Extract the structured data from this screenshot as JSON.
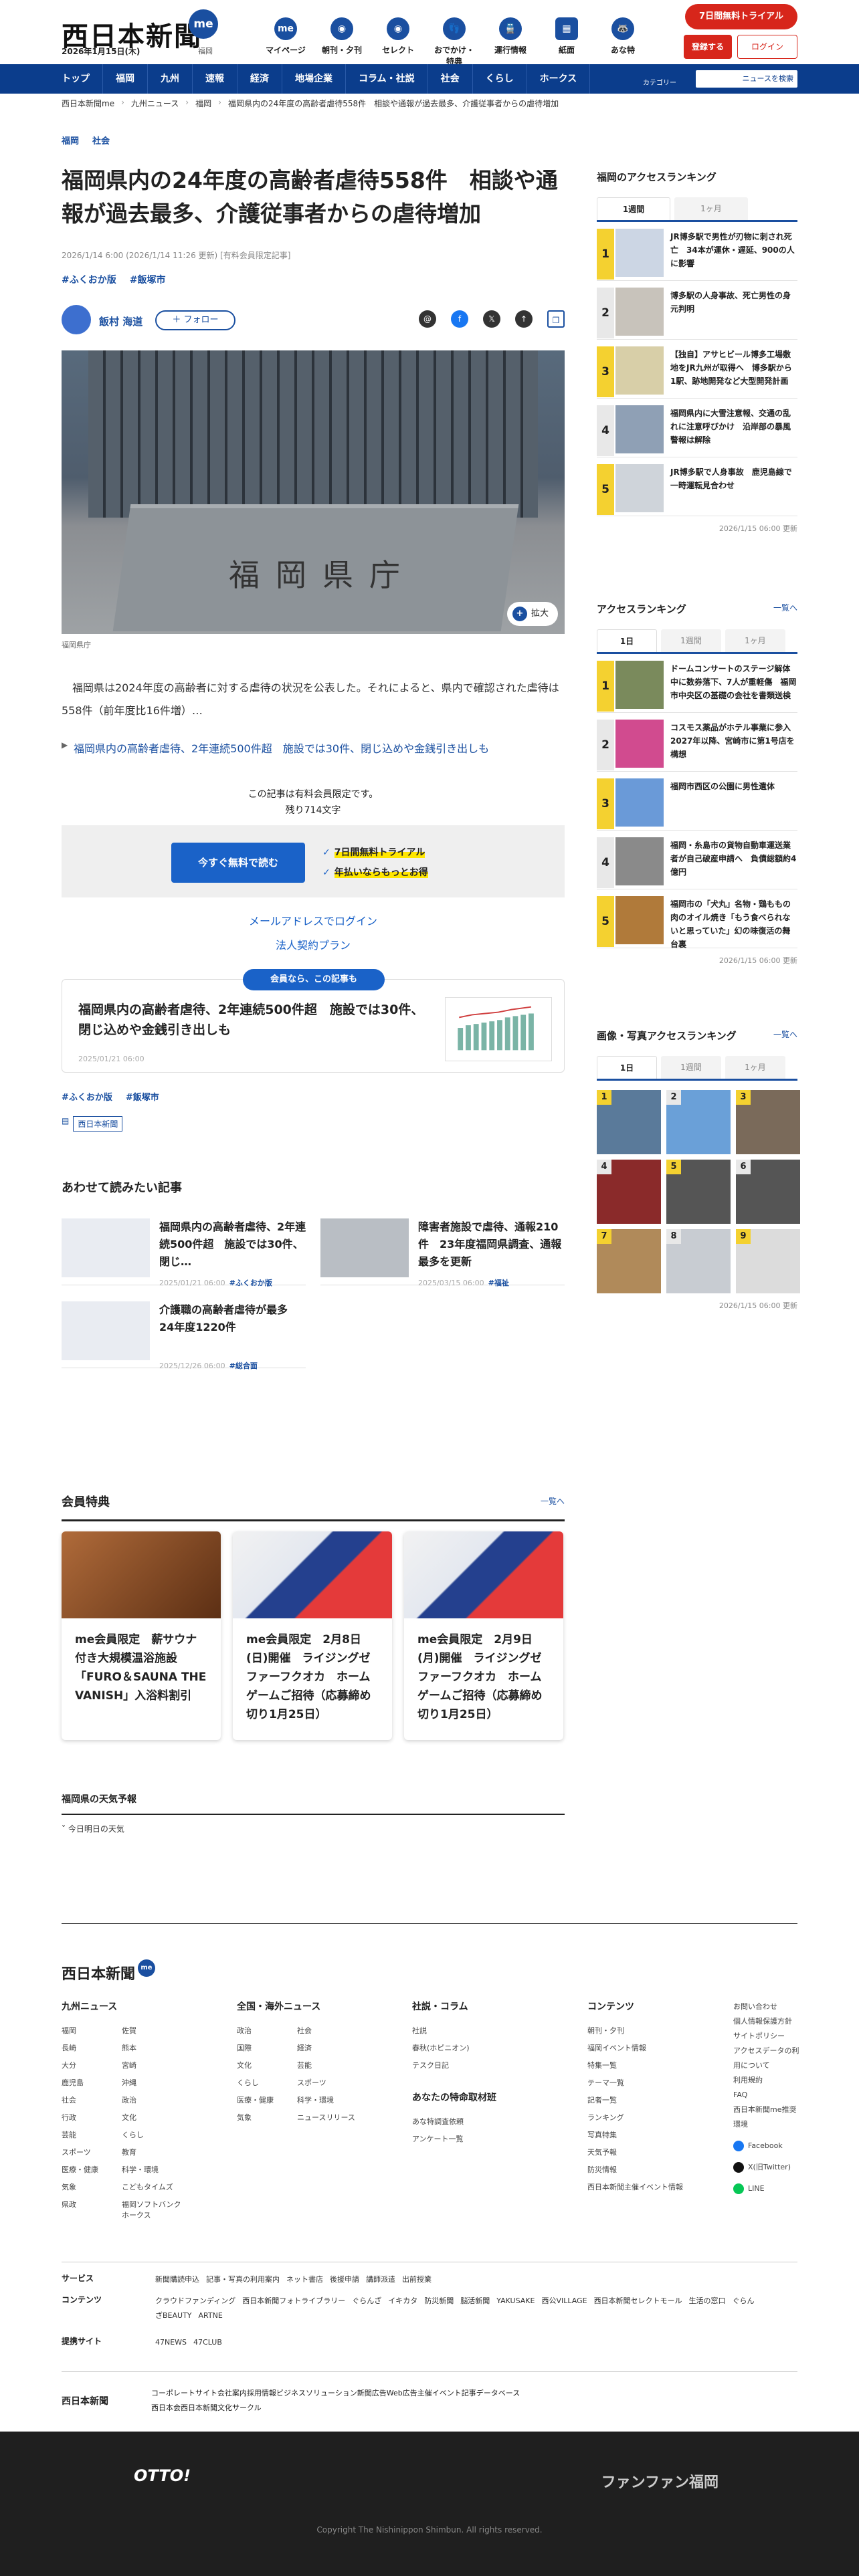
{
  "header": {
    "logo": "西日本新聞",
    "me": "me",
    "date": "2026年1月15日(木)",
    "location": "福岡",
    "icons": [
      {
        "label": "マイページ",
        "glyph": "me"
      },
      {
        "label": "朝刊・夕刊",
        "glyph": "◉"
      },
      {
        "label": "セレクト",
        "glyph": "◉"
      },
      {
        "label": "おでかけ・特典",
        "glyph": "👣"
      },
      {
        "label": "運行情報",
        "glyph": "🚆"
      },
      {
        "label": "紙面",
        "glyph": "▦"
      },
      {
        "label": "あな特",
        "glyph": "🦝"
      }
    ],
    "trial": "7日間無料トライアル",
    "register": "登録する",
    "login": "ログイン"
  },
  "nav": {
    "items": [
      "トップ",
      "福岡",
      "九州",
      "速報",
      "経済",
      "地場企業",
      "コラム・社説",
      "社会",
      "くらし",
      "ホークス"
    ],
    "category": "カテゴリー",
    "search_placeholder": "ニュースを検索"
  },
  "breadcrumb": [
    "西日本新聞me",
    "九州ニュース",
    "福岡",
    "福岡県内の24年度の高齢者虐待558件　相談や通報が過去最多、介護従事者からの虐待増加"
  ],
  "article": {
    "tags": [
      "福岡",
      "社会"
    ],
    "title": "福岡県内の24年度の高齢者虐待558件　相談や通報が過去最多、介護従事者からの虐待増加",
    "meta": "2026/1/14 6:00 (2026/1/14 11:26 更新)  [有料会員限定記事]",
    "topic_tags": [
      "#ふくおか版",
      "#飯塚市"
    ],
    "author": "飯村 海道",
    "follow": "＋ フォロー",
    "photo_sign": "福岡県庁",
    "zoom": "拡大",
    "caption": "福岡県庁",
    "lead": "　福岡県は2024年度の高齢者に対する虐待の状況を公表した。それによると、県内で確認された虐待は558件（前年度比16件増）…",
    "related": "福岡県内の高齢者虐待、2年連続500件超　施設では30件、閉じ込めや金銭引き出しも",
    "paywall_note": "この記事は有料会員限定です。",
    "remaining": "残り714文字",
    "cta": "今すぐ無料で読む",
    "perk1": "7日間無料トライアル",
    "perk2": "年払いならもっとお得",
    "email_login": "メールアドレスでログイン",
    "corp_plan": "法人契約プラン",
    "member_ribbon": "会員なら、この記事も",
    "member_card_title": "福岡県内の高齢者虐待、2年連続500件超　施設では30件、閉じ込めや金銭引き出しも",
    "member_card_date": "2025/01/21 06:00",
    "bottom_tags": [
      "#ふくおか版",
      "#飯塚市"
    ],
    "source": "西日本新聞"
  },
  "recommend": {
    "heading": "あわせて読みたい記事",
    "items": [
      {
        "title": "福岡県内の高齢者虐待、2年連続500件超　施設では30件、閉じ…",
        "date": "2025/01/21 06:00",
        "tag": "#ふくおか版"
      },
      {
        "title": "障害者施設で虐待、通報210件　23年度福岡県調査、通報最多を更新",
        "date": "2025/03/15 06:00",
        "tag": "#福祉"
      },
      {
        "title": "介護職の高齢者虐待が最多　24年度1220件",
        "date": "2025/12/26 06:00",
        "tag": "#総合面"
      }
    ]
  },
  "perks": {
    "heading": "会員特典",
    "more": "一覧へ",
    "items": [
      "me会員限定　薪サウナ付き大規模温浴施設「FURO＆SAUNA THE VANISH」入浴料割引",
      "me会員限定　2月8日(日)開催　ライジングゼファーフクオカ　ホームゲームご招待（応募締め切り1月25日）",
      "me会員限定　2月9日(月)開催　ライジングゼファーフクオカ　ホームゲームご招待（応募締め切り1月25日）"
    ]
  },
  "weather": {
    "heading": "福岡県の天気予報",
    "sub": "今日明日の天気"
  },
  "sidebar": {
    "access": {
      "heading": "福岡のアクセスランキング",
      "tabs": [
        "1週間",
        "1ヶ月"
      ],
      "items": [
        "JR博多駅で男性が刃物に刺され死亡　34本が運休・遅延、900の人に影響",
        "博多駅の人身事故、死亡男性の身元判明",
        "【独自】アサヒビール博多工場敷地をJR九州が取得へ　博多駅から1駅、跡地開発など大型開発計画",
        "福岡県内に大雪注意報、交通の乱れに注意呼びかけ　沿岸部の暴風警報は解除",
        "JR博多駅で人身事故　鹿児島線で一時運転見合わせ"
      ],
      "updated": "2026/1/15 06:00 更新"
    },
    "ranking": {
      "heading": "アクセスランキング",
      "more": "一覧へ",
      "tabs": [
        "1日",
        "1週間",
        "1ヶ月"
      ],
      "items": [
        "ドームコンサートのステージ解体中に数券落下、7人が重軽傷　福岡市中央区の基礎の会社を書類送検",
        "コスモス薬品がホテル事業に参入　2027年以降、宮崎市に第1号店を構想",
        "福岡市西区の公園に男性遺体",
        "福岡・糸島市の貨物自動車運送業者が自己破産申請へ　負債総額約4億円",
        "福岡市の「犬丸」名物・鶏ももの肉のオイル焼き「もう食べられないと思っていた」幻の味復活の舞台裏"
      ],
      "updated": "2026/1/15 06:00 更新"
    },
    "photo": {
      "heading": "画像・写真アクセスランキング",
      "more": "一覧へ",
      "tabs": [
        "1日",
        "1週間",
        "1ヶ月"
      ],
      "updated": "2026/1/15 06:00 更新"
    }
  },
  "footer": {
    "logo": "西日本新聞",
    "me": "me",
    "cols": [
      {
        "h": "九州ニュース",
        "items": [
          "福岡",
          "佐賀",
          "長崎",
          "熊本",
          "大分",
          "宮崎",
          "鹿児島",
          "沖縄",
          "社会",
          "政治",
          "行政",
          "文化",
          "芸能",
          "くらし",
          "スポーツ",
          "教育",
          "医療・健康",
          "科学・環境",
          "気象",
          "こどもタイムズ",
          "県政",
          "福岡ソフトバンクホークス"
        ]
      },
      {
        "h": "全国・海外ニュース",
        "items": [
          "政治",
          "社会",
          "国際",
          "経済",
          "文化",
          "芸能",
          "くらし",
          "スポーツ",
          "医療・健康",
          "科学・環境",
          "気象",
          "ニュースリリース"
        ]
      },
      {
        "h": "社説・コラム",
        "items": [
          "社説",
          "春秋(ホピニオン)",
          "テスク日記"
        ],
        "h2": "あなたの特命取材班",
        "items2": [
          "あな特調査依頼",
          "アンケート一覧"
        ]
      },
      {
        "h": "コンテンツ",
        "items": [
          "朝刊・夕刊",
          "福岡イベント情報",
          "特集一覧",
          "テーマ一覧",
          "記者一覧",
          "ランキング",
          "写真特集",
          "天気予報",
          "防災情報",
          "西日本新聞主催イベント情報"
        ]
      }
    ],
    "right": [
      "お問い合わせ",
      "個人情報保護方針",
      "サイトポリシー",
      "アクセスデータの利用について",
      "利用規約",
      "FAQ",
      "西日本新聞me推奨環境"
    ],
    "social": [
      "Facebook",
      "X(旧Twitter)",
      "LINE"
    ],
    "services_label": "サービス",
    "services": [
      "新聞購読申込",
      "記事・写真の利用案内",
      "ネット書店",
      "後援申請",
      "講師派遣",
      "出前授業"
    ],
    "contents_label": "コンテンツ",
    "contents": [
      "クラウドファンディング",
      "西日本新聞フォトライブラリー",
      "ぐらんざ",
      "イキカタ",
      "防災新聞",
      "脳活新聞",
      "YAKUSAKE",
      "西公VILLAGE",
      "西日本新聞セレクトモール",
      "生活の窓口",
      "ぐらんざBEAUTY",
      "ARTNE"
    ],
    "partners_label": "提携サイト",
    "partners": [
      "47NEWS",
      "47CLUB"
    ],
    "bottom": [
      "コーポレートサイト",
      "会社案内",
      "採用情報",
      "ビジネスソリューション",
      "新聞広告",
      "Web広告",
      "主催イベント",
      "記事データベース",
      "西日本会",
      "西日本新聞文化サークル"
    ],
    "bottom_logo": "西日本新聞",
    "otto": "OTTO!",
    "ff": "ファンファン福岡",
    "copyright": "Copyright The Nishinippon Shimbun. All rights reserved."
  }
}
